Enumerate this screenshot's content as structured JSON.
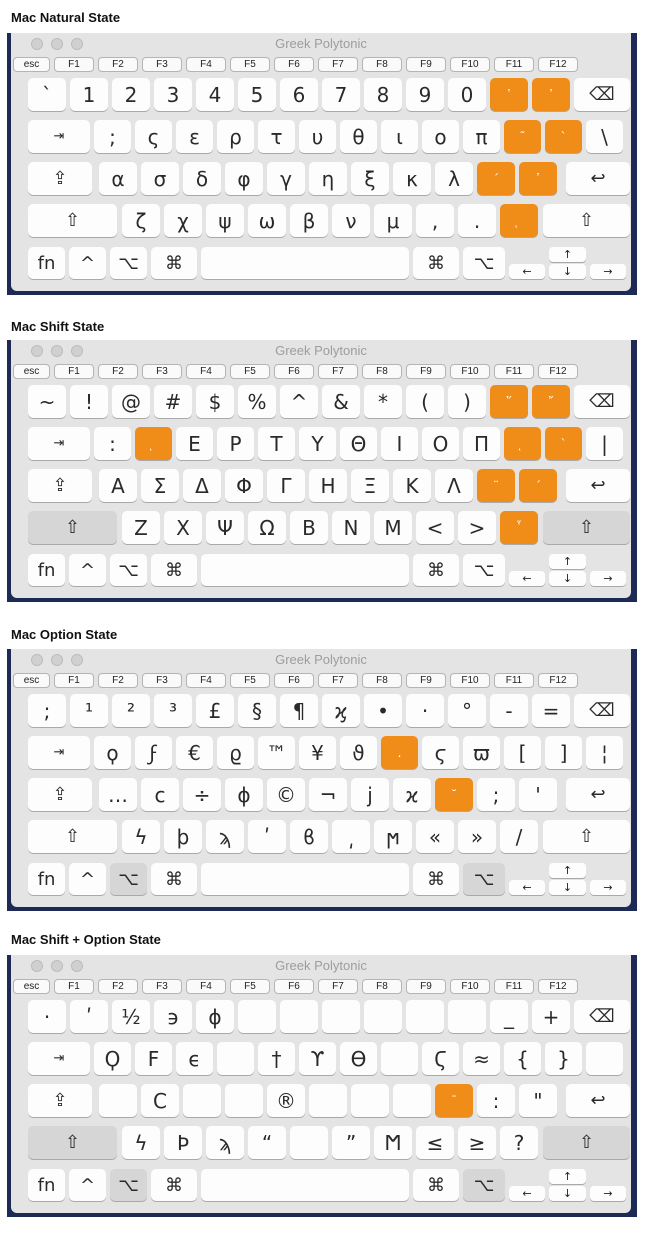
{
  "app_title": "Greek Polytonic",
  "function_keys": [
    "esc",
    "F1",
    "F2",
    "F3",
    "F4",
    "F5",
    "F6",
    "F7",
    "F8",
    "F9",
    "F10",
    "F11",
    "F12"
  ],
  "modifiers": {
    "tab": "⇥",
    "caps": "⇪",
    "shift": "⇧",
    "return": "↩",
    "delete": "⌫",
    "fn": "fn",
    "control": "^",
    "option": "⌥",
    "command": "⌘"
  },
  "arrows": {
    "up": "↑",
    "down": "↓",
    "left": "←",
    "right": "→"
  },
  "states": [
    {
      "caption": "Mac Natural State",
      "row1": [
        "`",
        "1",
        "2",
        "3",
        "4",
        "5",
        "6",
        "7",
        "8",
        "9",
        "0",
        "῾",
        "᾽"
      ],
      "row2": [
        ";",
        "ς",
        "ε",
        "ρ",
        "τ",
        "υ",
        "θ",
        "ι",
        "ο",
        "π",
        "῀",
        "`",
        "\\"
      ],
      "row3": [
        "α",
        "σ",
        "δ",
        "φ",
        "γ",
        "η",
        "ξ",
        "κ",
        "λ",
        "´",
        "᾽"
      ],
      "row4": [
        "ζ",
        "χ",
        "ψ",
        "ω",
        "β",
        "ν",
        "μ",
        ",",
        ".",
        "ͅ"
      ]
    },
    {
      "caption": "Mac Shift State",
      "row1": [
        "~",
        "!",
        "@",
        "#",
        "$",
        "%",
        "^",
        "&",
        "*",
        "(",
        ")",
        "῞",
        "῎"
      ],
      "row2": [
        ":",
        "ͅ",
        "Ε",
        "Ρ",
        "Τ",
        "Υ",
        "Θ",
        "Ι",
        "Ο",
        "Π",
        "ͅ",
        "`",
        "|"
      ],
      "row3": [
        "Α",
        "Σ",
        "Δ",
        "Φ",
        "Γ",
        "Η",
        "Ξ",
        "Κ",
        "Λ",
        "¨",
        "΄"
      ],
      "row4": [
        "Ζ",
        "Χ",
        "Ψ",
        "Ω",
        "Β",
        "Ν",
        "Μ",
        "<",
        ">",
        "῟"
      ]
    },
    {
      "caption": "Mac Option State",
      "row1": [
        ";",
        "¹",
        "²",
        "³",
        "£",
        "§",
        "¶",
        "ϗ",
        "•",
        "·",
        "°",
        "-",
        "="
      ],
      "row2": [
        "ϙ",
        "ϝ",
        "€",
        "ϱ",
        "™",
        "¥",
        "ϑ",
        ".",
        "ϛ",
        "ϖ",
        "[",
        "]",
        "¦"
      ],
      "row3": [
        "…",
        "ϲ",
        "÷",
        "ϕ",
        "©",
        "¬",
        "ϳ",
        "ϰ",
        "˘",
        ";",
        "'"
      ],
      "row4": [
        "ϟ",
        "ϸ",
        "ϡ",
        "ʹ",
        "ϐ",
        "͵",
        "ϻ",
        "«",
        "»",
        "/"
      ]
    },
    {
      "caption": "Mac Shift + Option State",
      "row1": [
        "·",
        "ʹ",
        "½",
        "϶",
        "ϕ",
        "",
        "",
        "",
        "",
        "",
        "",
        "_",
        "+"
      ],
      "row2": [
        "Ϙ",
        "Ϝ",
        "ϵ",
        "",
        "†",
        "ϒ",
        "ϴ",
        "",
        "Ϛ",
        "≈",
        "{",
        "}",
        ""
      ],
      "row3": [
        "",
        "Ϲ",
        "",
        "",
        "®",
        "",
        "",
        "",
        "¯",
        ":",
        "\""
      ],
      "row4": [
        "ϟ",
        "Ϸ",
        "ϡ",
        "“",
        "",
        "”",
        "Ϻ",
        "≤",
        "≥",
        "?"
      ]
    }
  ],
  "colors": {
    "accent_orange": "#f08c18",
    "desktop": "#1d2a55",
    "key": "#fdfdfd",
    "window": "#e4e4e4"
  }
}
